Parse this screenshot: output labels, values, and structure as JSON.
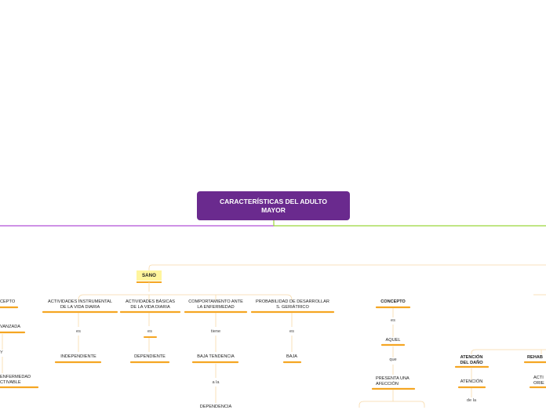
{
  "root": {
    "line1": "CARACTERÍSTICAS DEL ADULTO",
    "line2": "MAYOR"
  },
  "colors": {
    "root": "#6a2a8e",
    "purple_line": "#b04fd8",
    "green_line": "#9ad63a",
    "orange": "#f5a623",
    "thin_orange": "#f7d9a8",
    "sano_bg": "#fff59d"
  },
  "sano": "SANO",
  "left_branch": {
    "concepto_partial": "CEPTO",
    "avanzada_partial": "VANZADA",
    "y_partial": "Y",
    "enfermedad_line1": "ENFERMEDAD",
    "enfermedad_line2": "CTIVABLE"
  },
  "categories": [
    {
      "line1": "ACTIVIDADES INSTRUMENTAL",
      "line2": "DE LA VIDA DIARIA",
      "connector": "es",
      "value": "INDEPENDIENTE"
    },
    {
      "line1": "ACTIVIDADES BÁSICAS",
      "line2": "DE LA VIDA DIARIA",
      "connector": "es",
      "value": "DEPENDIENTE"
    },
    {
      "line1": "COMPORTAMIENTO ANTE",
      "line2": "LA ENFERMEDAD",
      "connector": "tiene",
      "value": "BAJA TENDENCIA",
      "connector2": "a la",
      "value2_partial": "DEPENDENCIA"
    },
    {
      "line1": "PROBABILIDAD DE DESARROLLAR",
      "line2": "S. GERIÁTRICO",
      "connector": "es",
      "value": "BAJA"
    }
  ],
  "right_branch": {
    "concepto": "CONCEPTO",
    "connector1": "es",
    "aquel": "AQUEL",
    "connector2": "que",
    "presenta_line1": "PRESENTA UNA",
    "presenta_line2": "AFECCIÓN",
    "atencion_line1": "ATENCIÓN",
    "atencion_line2": "DEL DAÑO",
    "atencion_child": "ATENCIÓN",
    "de_la": "de la",
    "rehab_partial": "REHAB",
    "acti_partial": "ACTI",
    "orie_partial": "ORIE"
  }
}
